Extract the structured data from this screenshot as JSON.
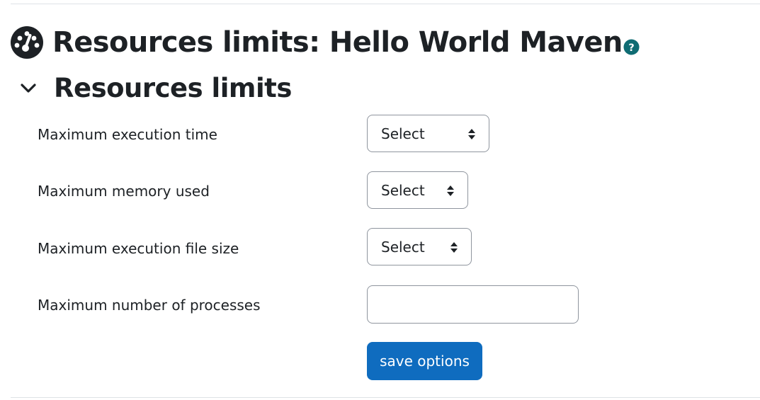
{
  "page": {
    "title": "Resources limits: Hello World Maven",
    "icon": "dashboard-gauge-icon",
    "help_icon": "question-circle-icon"
  },
  "section": {
    "title": "Resources limits",
    "expanded": true,
    "toggle_icon": "chevron-down-icon"
  },
  "form": {
    "fields": [
      {
        "label": "Maximum execution time",
        "type": "select",
        "value": "Select"
      },
      {
        "label": "Maximum memory used",
        "type": "select",
        "value": "Select"
      },
      {
        "label": "Maximum execution file size",
        "type": "select",
        "value": "Select"
      },
      {
        "label": "Maximum number of processes",
        "type": "text",
        "value": ""
      }
    ],
    "submit_label": "save options"
  },
  "colors": {
    "primary": "#0f6cbf",
    "text": "#1d2125",
    "help_icon": "#0f6c73",
    "border": "#8f959e",
    "divider": "#dee2e6"
  }
}
